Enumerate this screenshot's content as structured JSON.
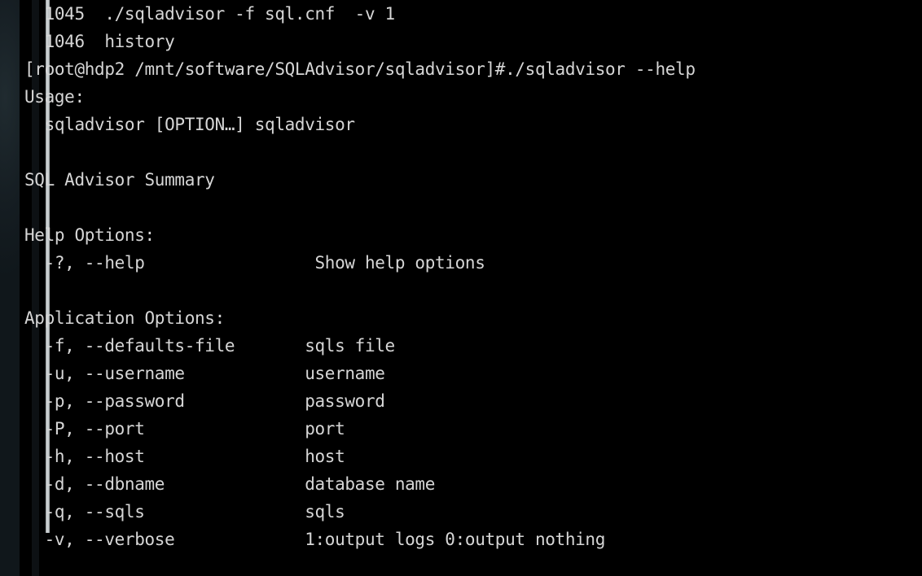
{
  "window": {
    "type": "terminal-emulator",
    "background_color": "#000000",
    "foreground_color": "#d6d6d6",
    "wallpaper_color": "#1a2228",
    "scrollbar_color": "#c8cccd"
  },
  "terminal": {
    "history": [
      {
        "number": "1045",
        "command": "./sqladvisor -f sql.cnf  -v 1"
      },
      {
        "number": "1046",
        "command": "history"
      }
    ],
    "prompt": {
      "user": "root",
      "host": "hdp2",
      "path": "/mnt/software/SQLAdvisor/sqladvisor",
      "symbol": "#",
      "full": "[root@hdp2 /mnt/software/SQLAdvisor/sqladvisor]#",
      "command": "./sqladvisor --help"
    },
    "output": {
      "usage_header": "Usage:",
      "usage_line": "sqladvisor [OPTION…] sqladvisor",
      "summary": "SQL Advisor Summary",
      "help_header": "Help Options:",
      "help_options": [
        {
          "flags": "-?, --help",
          "description": "Show help options"
        }
      ],
      "application_header": "Application Options:",
      "application_options": [
        {
          "flags": "-f, --defaults-file",
          "description": "sqls file"
        },
        {
          "flags": "-u, --username",
          "description": "username"
        },
        {
          "flags": "-p, --password",
          "description": "password"
        },
        {
          "flags": "-P, --port",
          "description": "port"
        },
        {
          "flags": "-h, --host",
          "description": "host"
        },
        {
          "flags": "-d, --dbname",
          "description": "database name"
        },
        {
          "flags": "-q, --sqls",
          "description": "sqls"
        },
        {
          "flags": "-v, --verbose",
          "description": "1:output logs 0:output nothing"
        }
      ]
    },
    "rendered_lines": [
      "  1045  ./sqladvisor -f sql.cnf  -v 1",
      "  1046  history",
      "[root@hdp2 /mnt/software/SQLAdvisor/sqladvisor]#./sqladvisor --help",
      "Usage:",
      "  sqladvisor [OPTION…] sqladvisor",
      "",
      "SQL Advisor Summary",
      "",
      "Help Options:",
      "  -?, --help                 Show help options",
      "",
      "Application Options:",
      "  -f, --defaults-file       sqls file",
      "  -u, --username            username",
      "  -p, --password            password",
      "  -P, --port                port",
      "  -h, --host                host",
      "  -d, --dbname              database name",
      "  -q, --sqls                sqls",
      "  -v, --verbose             1:output logs 0:output nothing",
      ""
    ]
  }
}
